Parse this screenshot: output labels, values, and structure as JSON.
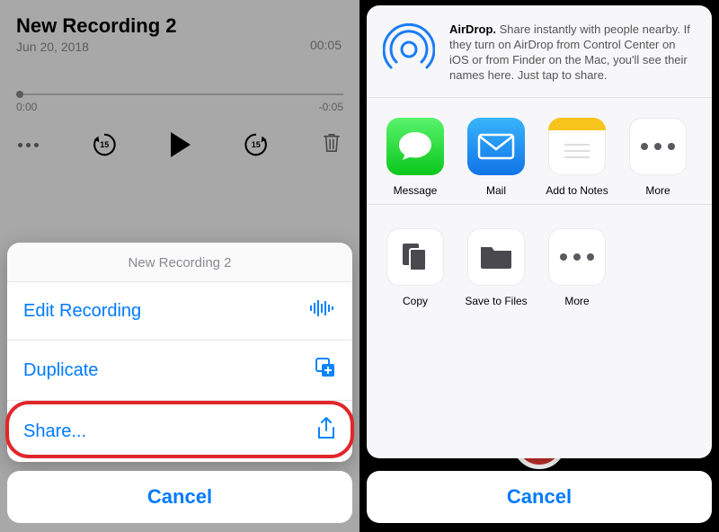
{
  "left": {
    "title": "New Recording 2",
    "date": "Jun 20, 2018",
    "duration": "00:05",
    "scrub_start": "0:00",
    "scrub_end": "-0:05",
    "skip15": "15",
    "sheet_title": "New Recording 2",
    "menu": {
      "edit": "Edit Recording",
      "duplicate": "Duplicate",
      "share": "Share..."
    },
    "cancel": "Cancel"
  },
  "right": {
    "airdrop_bold": "AirDrop.",
    "airdrop_text": " Share instantly with people nearby. If they turn on AirDrop from Control Center on iOS or from Finder on the Mac, you'll see their names here. Just tap to share.",
    "apps": {
      "message": "Message",
      "mail": "Mail",
      "notes": "Add to Notes",
      "more": "More"
    },
    "actions": {
      "copy": "Copy",
      "save": "Save to Files",
      "more": "More"
    },
    "cancel": "Cancel"
  }
}
